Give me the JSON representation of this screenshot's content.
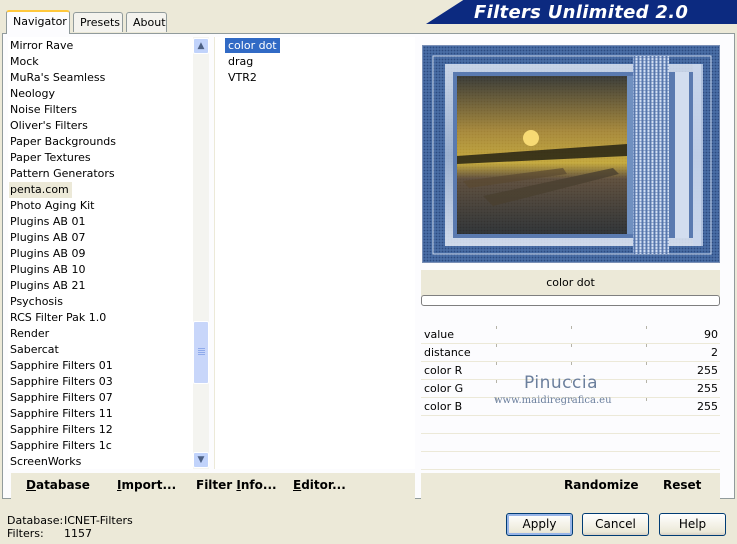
{
  "window": {
    "title": "Filters Unlimited 2.0"
  },
  "tabs": [
    {
      "label": "Navigator",
      "active": true
    },
    {
      "label": "Presets",
      "active": false
    },
    {
      "label": "About",
      "active": false
    }
  ],
  "categories": {
    "items": [
      "Mirror Rave",
      "Mock",
      "MuRa's Seamless",
      "Neology",
      "Noise Filters",
      "Oliver's Filters",
      "Paper Backgrounds",
      "Paper Textures",
      "Pattern Generators",
      "penta.com",
      "Photo Aging Kit",
      "Plugins AB 01",
      "Plugins AB 07",
      "Plugins AB 09",
      "Plugins AB 10",
      "Plugins AB 21",
      "Psychosis",
      "RCS Filter Pak 1.0",
      "Render",
      "Sabercat",
      "Sapphire Filters 01",
      "Sapphire Filters 03",
      "Sapphire Filters 07",
      "Sapphire Filters 11",
      "Sapphire Filters 12",
      "Sapphire Filters 1c",
      "ScreenWorks"
    ],
    "selected": "penta.com"
  },
  "filters": {
    "items": [
      "color dot",
      "drag",
      "VTR2"
    ],
    "selected": "color dot"
  },
  "preview": {
    "filter_name": "color dot"
  },
  "params": [
    {
      "label": "value",
      "value": "90"
    },
    {
      "label": "distance",
      "value": "2"
    },
    {
      "label": "color R",
      "value": "255"
    },
    {
      "label": "color G",
      "value": "255"
    },
    {
      "label": "color B",
      "value": "255"
    }
  ],
  "watermark": {
    "name": "Pinuccia",
    "site": "www.maidiregrafica.eu"
  },
  "toolbar": {
    "database": {
      "u": "D",
      "rest": "atabase"
    },
    "import": {
      "pre": "",
      "u": "I",
      "rest": "mport..."
    },
    "filter_info": {
      "pre": "Filter ",
      "u": "I",
      "rest": "nfo..."
    },
    "editor": {
      "pre": "",
      "u": "E",
      "rest": "ditor..."
    },
    "randomize": "Randomize",
    "reset": "Reset"
  },
  "status": {
    "database_label": "Database:",
    "database_value": "ICNET-Filters",
    "filters_label": "Filters:",
    "filters_value": "1157"
  },
  "buttons": {
    "apply": "Apply",
    "cancel": "Cancel",
    "help": "Help"
  },
  "colors": {
    "banner": "#0c2a80",
    "selection": "#316ac5",
    "xp_face": "#ece9d8"
  }
}
